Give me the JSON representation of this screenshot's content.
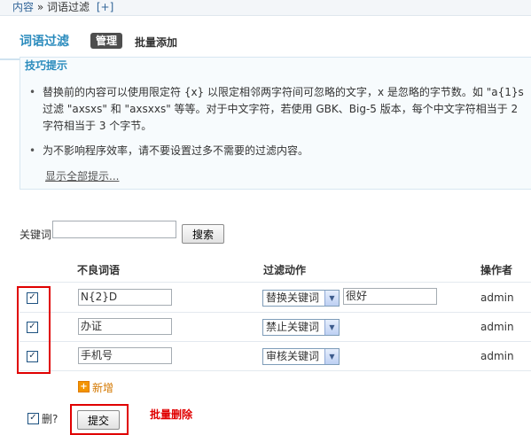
{
  "breadcrumb": {
    "root": "内容",
    "separator": "»",
    "current": "词语过滤",
    "add": "[+]"
  },
  "header": {
    "title": "词语过滤",
    "tabs": [
      {
        "label": "管理",
        "active": true
      },
      {
        "label": "批量添加",
        "active": false
      }
    ]
  },
  "tips": {
    "title": "技巧提示",
    "items": [
      {
        "lines": [
          "替换前的内容可以使用限定符 {x} 以限定相邻两字符间可忽略的文字，x 是忽略的字节数。如 \"a{1}s",
          "过滤 \"axsxs\" 和 \"axsxxs\" 等等。对于中文字符，若使用 GBK、Big-5 版本，每个中文字符相当于 2",
          "字符相当于 3 个字节。"
        ]
      },
      {
        "lines": [
          "为不影响程序效率，请不要设置过多不需要的过滤内容。"
        ]
      }
    ],
    "show_all": "显示全部提示..."
  },
  "search": {
    "label": "关键词",
    "value": "",
    "button": "搜索"
  },
  "table": {
    "headers": {
      "word": "不良词语",
      "action": "过滤动作",
      "operator": "操作者"
    },
    "rows": [
      {
        "checked": true,
        "word": "N{2}D",
        "action": "替换关键词",
        "replacement": "很好",
        "operator": "admin"
      },
      {
        "checked": true,
        "word": "办证",
        "action": "禁止关键词",
        "operator": "admin"
      },
      {
        "checked": true,
        "word": "手机号",
        "action": "审核关键词",
        "operator": "admin"
      }
    ]
  },
  "add_label": "新增",
  "footer": {
    "select_all_label": "删?",
    "select_all_checked": true,
    "submit": "提交",
    "annotation": "批量删除"
  },
  "colors": {
    "title": "#2a8bbd",
    "highlight_border": "#e00000",
    "add_link": "#d47800",
    "annotation": "#e00000"
  }
}
